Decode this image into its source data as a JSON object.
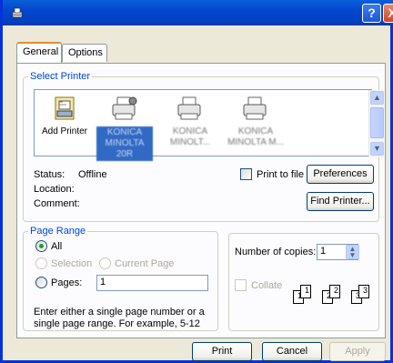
{
  "titlebar": {
    "help_label": "?",
    "close_label": "X"
  },
  "tabs": [
    {
      "label": "General"
    },
    {
      "label": "Options"
    }
  ],
  "select_printer": {
    "legend": "Select Printer",
    "printers": [
      {
        "label": "Add Printer"
      },
      {
        "label": "KONICA MINOLTA 20R"
      },
      {
        "label": "KONICA MINOLT..."
      },
      {
        "label": "KONICA MINOLTA M..."
      }
    ],
    "status_label": "Status:",
    "status_value": "Offline",
    "location_label": "Location:",
    "comment_label": "Comment:",
    "print_to_file_label": "Print to file",
    "preferences_label": "Preferences",
    "find_printer_label": "Find Printer..."
  },
  "page_range": {
    "legend": "Page Range",
    "all_label": "All",
    "selection_label": "Selection",
    "current_page_label": "Current Page",
    "pages_label": "Pages:",
    "pages_value": "1",
    "help_text": "Enter either a single page number or a single page range.  For example, 5-12"
  },
  "copies": {
    "number_label": "Number of copies:",
    "number_value": "1",
    "collate_label": "Collate",
    "pages": [
      "1",
      "1",
      "2",
      "2",
      "3",
      "3"
    ]
  },
  "footer": {
    "print_label": "Print",
    "cancel_label": "Cancel",
    "apply_label": "Apply"
  },
  "colors": {
    "titlebar": "#0247d0",
    "legend": "#0046d5",
    "selection": "#316ac5"
  }
}
